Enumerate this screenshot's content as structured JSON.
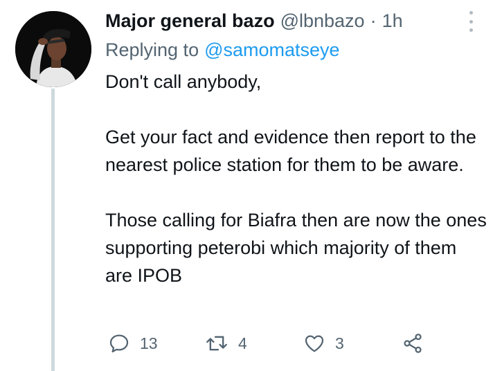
{
  "author": {
    "display_name": "Major general bazo",
    "handle": "@lbnbazo",
    "separator": "·",
    "time": "1h"
  },
  "replying": {
    "prefix": "Replying to",
    "mention": "@samomatseye"
  },
  "tweet": {
    "paragraphs": [
      "Don't call anybody,",
      "Get your fact and evidence then report to the nearest police station for them to be aware.",
      "Those calling for Biafra then are now the ones supporting peterobi which majority of them are IPOB"
    ]
  },
  "actions": {
    "replies": "13",
    "retweets": "4",
    "likes": "3"
  },
  "icons": {
    "reply": "reply-icon",
    "retweet": "retweet-icon",
    "like": "heart-icon",
    "share": "share-icon",
    "more": "more-options-icon"
  },
  "colors": {
    "text": "#0f1419",
    "secondary": "#536471",
    "link": "#1d9bf0",
    "thread_line": "#cfd9de"
  }
}
